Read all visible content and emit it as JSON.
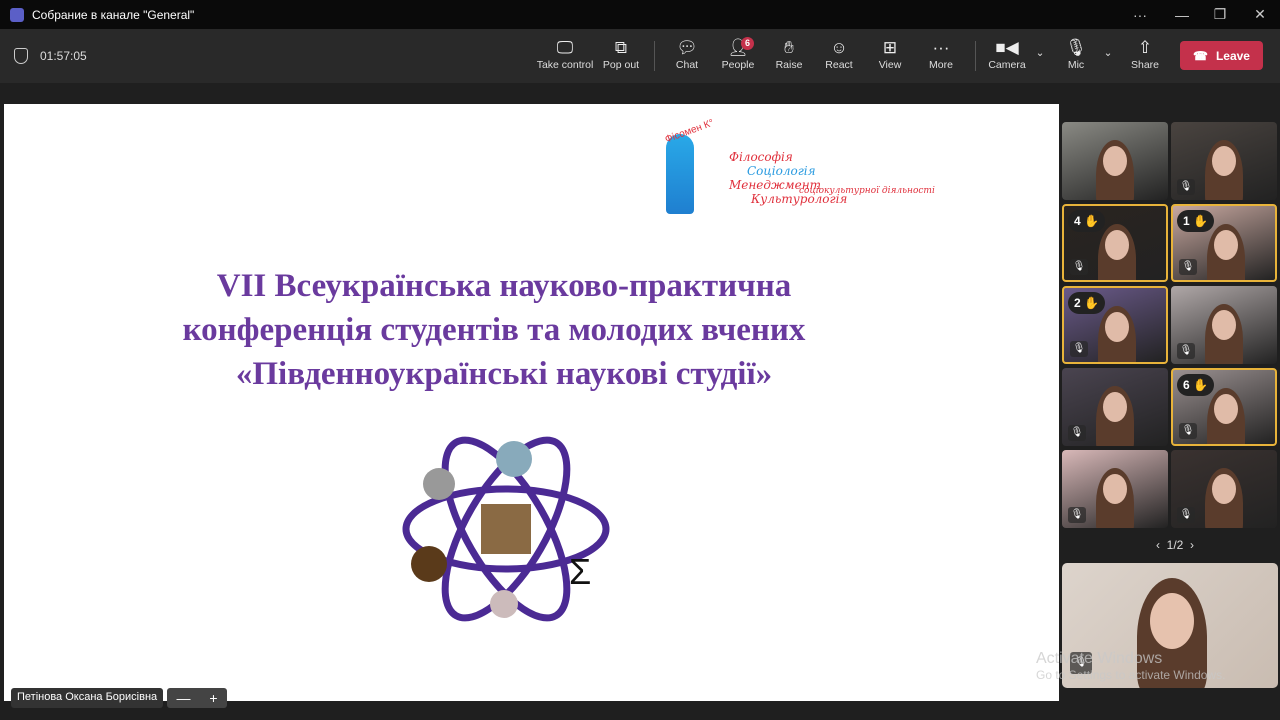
{
  "window": {
    "title": "Собрание в канале \"General\"",
    "more": "···",
    "minimize": "—",
    "restore": "❐",
    "close": "✕"
  },
  "toolbar": {
    "timer": "01:57:05",
    "take_control": "Take control",
    "pop_out": "Pop out",
    "chat": "Chat",
    "people": "People",
    "people_count": "6",
    "raise": "Raise",
    "react": "React",
    "view": "View",
    "more": "More",
    "camera": "Camera",
    "mic": "Mic",
    "share": "Share",
    "leave": "Leave"
  },
  "slide": {
    "logo_tag": "Фісомен К°",
    "logo_lines": [
      "Філософія",
      "Соціологія",
      "Менеджмент",
      "соціокультурної діяльності",
      "Культурологія"
    ],
    "heading": [
      "VII Всеукраїнська науково-практична",
      "конференція студентів та молодих вчених",
      "«Південноукраїнські наукові студії»"
    ],
    "presenter": "Петінова Оксана Борисівна",
    "zoom_out": "—",
    "zoom_in": "+"
  },
  "participants": [
    {
      "hand": null
    },
    {
      "hand": null
    },
    {
      "hand": "4"
    },
    {
      "hand": "1"
    },
    {
      "hand": "2"
    },
    {
      "hand": null
    },
    {
      "hand": null
    },
    {
      "hand": "6"
    },
    {
      "hand": null
    },
    {
      "hand": null
    }
  ],
  "pager": {
    "label": "1/2",
    "prev": "‹",
    "next": "›"
  },
  "watermark": {
    "title": "Activate Windows",
    "subtitle": "Go to Settings to activate Windows."
  },
  "icons": {
    "hand": "✋",
    "mic_off": "🎙"
  }
}
